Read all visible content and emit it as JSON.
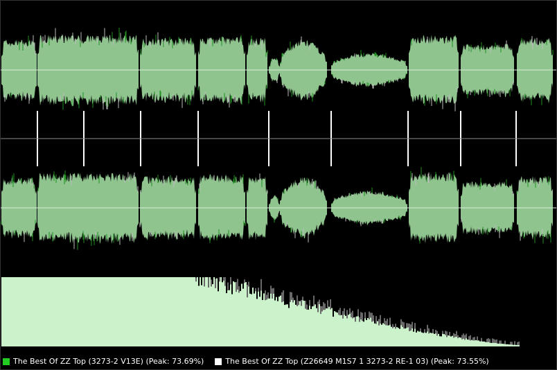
{
  "legend": {
    "items": [
      {
        "label": "The Best Of ZZ Top (3273-2 V13E) (Peak: 73.69%)",
        "color": "#22cc22"
      },
      {
        "label": "The Best Of ZZ Top (Z26649 M1S7 1 3273-2 RE-1 03) (Peak: 73.55%)",
        "color": "#ffffff"
      }
    ]
  },
  "colors": {
    "background": "#000000",
    "waveform_fill": "#8fc48f",
    "waveform_green_peaks": "#1f8f1f",
    "waveform_white_peaks": "#bbbbbb",
    "center_line": "#d8efd8",
    "divider_line": "#8a8a8a",
    "marker": "#ffffff",
    "spectrum_fill": "#ccf2cc",
    "spectrum_white": "#d0d0d0"
  }
}
